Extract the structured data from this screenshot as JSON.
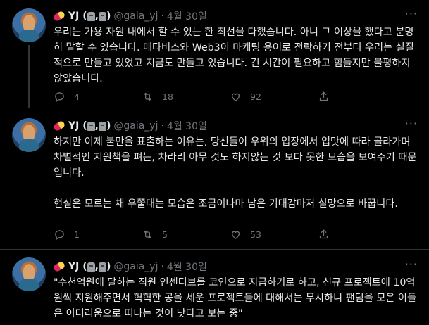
{
  "tweets": [
    {
      "name": "YJ (",
      "name_sep": ",",
      "name_close": ")",
      "handle": "@gaia_yj",
      "separator": "·",
      "date": "4월 30일",
      "text": "우리는 가용 자원 내에서 할 수 있는 한 최선을 다했습니다. 아니 그 이상을 했다고 분명히 말할 수 있습니다. 메타버스와 Web3이 마케팅 용어로 전락하기 전부터 우리는 실질적으로 만들고 있었고 지금도 만들고 있습니다. 긴 시간이 필요하고 힘들지만 불평하지 않았습니다.",
      "replies": "4",
      "retweets": "18",
      "likes": "92"
    },
    {
      "name": "YJ (",
      "name_sep": ",",
      "name_close": ")",
      "handle": "@gaia_yj",
      "separator": "·",
      "date": "4월 30일",
      "text": "하지만 이제 불만을 표출하는 이유는, 당신들이 우위의 입장에서 입맛에 따라 골라가며 차별적인 지원책을 펴는, 차라리 아무 것도 하지않는 것 보다 못한 모습을 보여주기 때문입니다.\n\n현실은 모르는 채 우쭐대는 모습은 조금이나마 남은 기대감마저 실망으로 바꿉니다.",
      "replies": "1",
      "retweets": "5",
      "likes": "53"
    },
    {
      "name": "YJ (",
      "name_sep": ",",
      "name_close": ")",
      "handle": "@gaia_yj",
      "separator": "·",
      "date": "4월 30일",
      "text": "\"수천억원에 달하는 직원 인센티브를 코인으로 지급하기로 하고, 신규 프로젝트에 10억원씩 지원해주면서 혁혁한 공을 세운 프로젝트들에 대해서는 무시하니 팬덤을 모은 이들은 이더리움으로 떠나는 것이 낫다고 보는 중\""
    }
  ],
  "colors": {
    "background": "#000000",
    "text": "#e7e9ea",
    "muted": "#71767b",
    "divider": "#2f3336"
  }
}
